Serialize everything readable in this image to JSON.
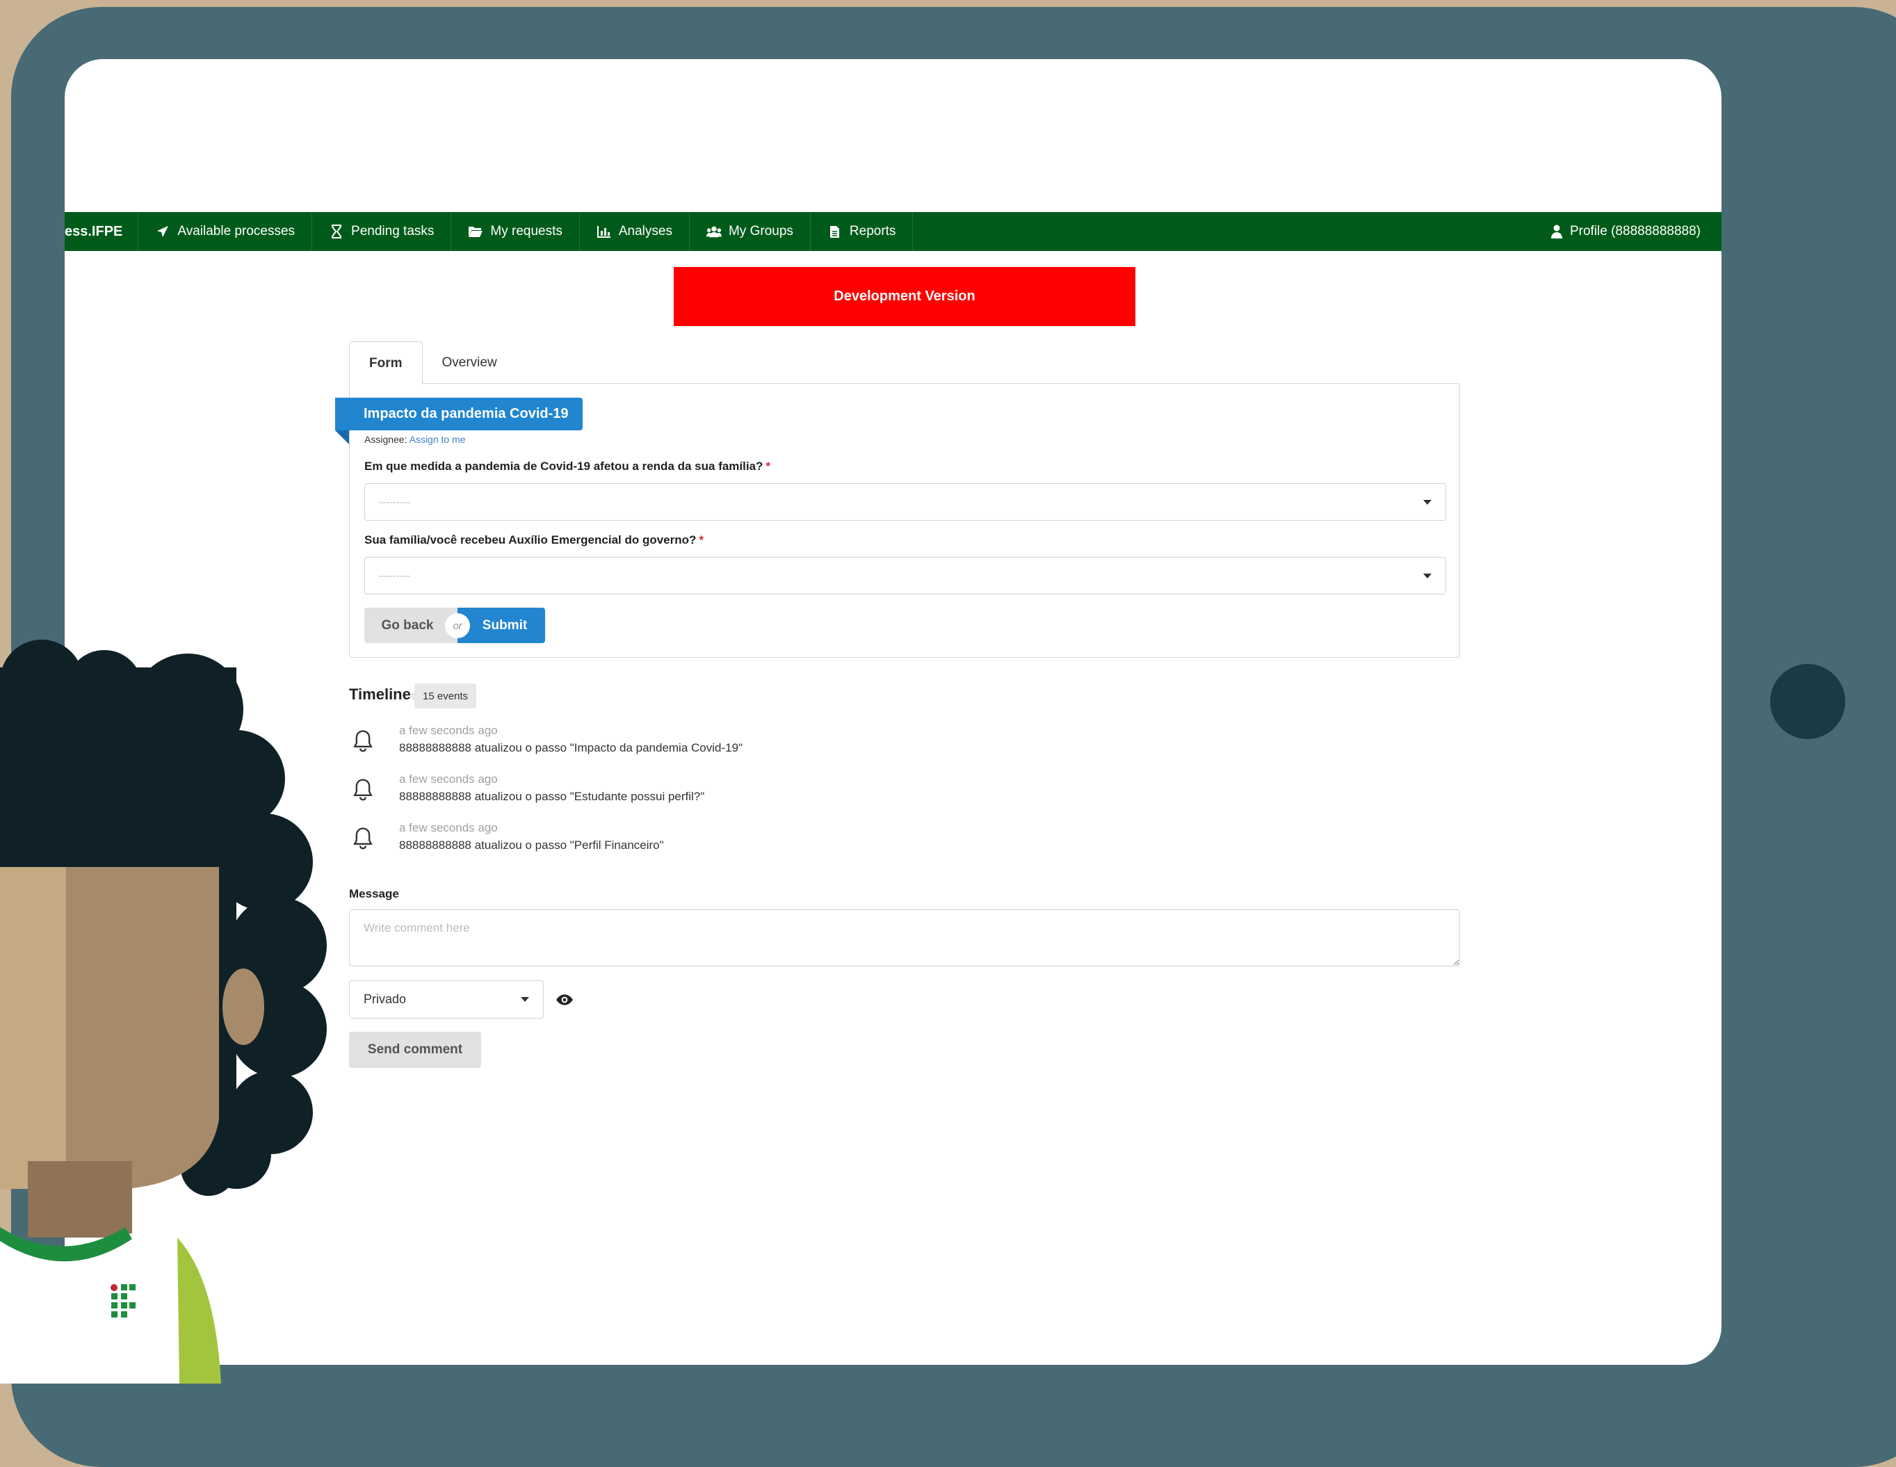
{
  "navbar": {
    "brand": "ess.IFPE",
    "items": [
      {
        "label": "Available processes",
        "icon": "paper-plane-icon"
      },
      {
        "label": "Pending tasks",
        "icon": "hourglass-icon"
      },
      {
        "label": "My requests",
        "icon": "folder-open-icon"
      },
      {
        "label": "Analyses",
        "icon": "chart-icon"
      },
      {
        "label": "My Groups",
        "icon": "users-icon"
      },
      {
        "label": "Reports",
        "icon": "file-icon"
      }
    ],
    "profile": "Profile (88888888888)"
  },
  "banner": "Development Version",
  "tabs": {
    "form": "Form",
    "overview": "Overview"
  },
  "task": {
    "title": "Impacto da pandemia Covid-19",
    "assignee_label": "Assignee:",
    "assign_link": "Assign to me"
  },
  "questions": [
    {
      "label": "Em que medida a pandemia de Covid-19 afetou a renda da sua família?",
      "required_mark": "*",
      "value": "---------"
    },
    {
      "label": "Sua família/você recebeu Auxílio Emergencial do governo?",
      "required_mark": "*",
      "value": "---------"
    }
  ],
  "buttons": {
    "back": "Go back",
    "or": "or",
    "submit": "Submit"
  },
  "timeline": {
    "title": "Timeline",
    "count": "15 events",
    "events": [
      {
        "time": "a few seconds ago",
        "text": "88888888888 atualizou o passo \"Impacto da pandemia Covid-19\""
      },
      {
        "time": "a few seconds ago",
        "text": "88888888888 atualizou o passo \"Estudante possui perfil?\""
      },
      {
        "time": "a few seconds ago",
        "text": "88888888888 atualizou o passo \"Perfil Financeiro\""
      }
    ]
  },
  "comment": {
    "label": "Message",
    "placeholder": "Write comment here",
    "visibility": "Privado",
    "send": "Send comment"
  },
  "colors": {
    "navbar": "#005b1a",
    "banner": "#ff0000",
    "primary": "#2185d0",
    "frame": "#476a75",
    "background": "#c9b394"
  }
}
